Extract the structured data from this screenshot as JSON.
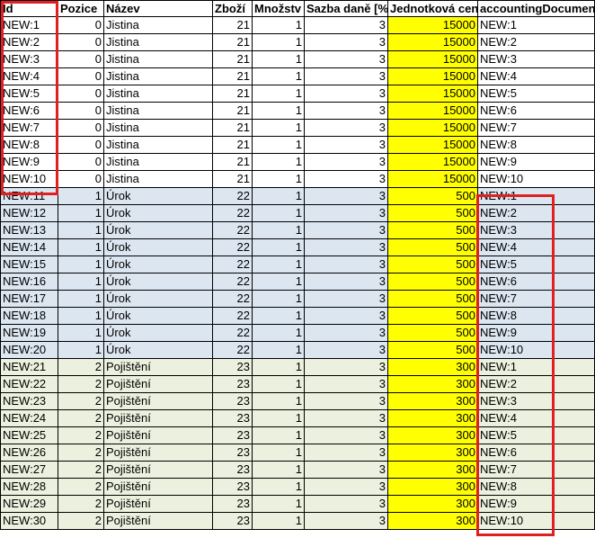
{
  "columns": [
    "Id",
    "Pozice",
    "Název",
    "Zboží",
    "Množstv",
    "Sazba daně [%",
    "Jednotková cen",
    "accountingDocumen"
  ],
  "rows": [
    [
      "NEW:1",
      "0",
      "Jistina",
      "21",
      "1",
      "3",
      "15000",
      "NEW:1"
    ],
    [
      "NEW:2",
      "0",
      "Jistina",
      "21",
      "1",
      "3",
      "15000",
      "NEW:2"
    ],
    [
      "NEW:3",
      "0",
      "Jistina",
      "21",
      "1",
      "3",
      "15000",
      "NEW:3"
    ],
    [
      "NEW:4",
      "0",
      "Jistina",
      "21",
      "1",
      "3",
      "15000",
      "NEW:4"
    ],
    [
      "NEW:5",
      "0",
      "Jistina",
      "21",
      "1",
      "3",
      "15000",
      "NEW:5"
    ],
    [
      "NEW:6",
      "0",
      "Jistina",
      "21",
      "1",
      "3",
      "15000",
      "NEW:6"
    ],
    [
      "NEW:7",
      "0",
      "Jistina",
      "21",
      "1",
      "3",
      "15000",
      "NEW:7"
    ],
    [
      "NEW:8",
      "0",
      "Jistina",
      "21",
      "1",
      "3",
      "15000",
      "NEW:8"
    ],
    [
      "NEW:9",
      "0",
      "Jistina",
      "21",
      "1",
      "3",
      "15000",
      "NEW:9"
    ],
    [
      "NEW:10",
      "0",
      "Jistina",
      "21",
      "1",
      "3",
      "15000",
      "NEW:10"
    ],
    [
      "NEW:11",
      "1",
      "Úrok",
      "22",
      "1",
      "3",
      "500",
      "NEW:1"
    ],
    [
      "NEW:12",
      "1",
      "Úrok",
      "22",
      "1",
      "3",
      "500",
      "NEW:2"
    ],
    [
      "NEW:13",
      "1",
      "Úrok",
      "22",
      "1",
      "3",
      "500",
      "NEW:3"
    ],
    [
      "NEW:14",
      "1",
      "Úrok",
      "22",
      "1",
      "3",
      "500",
      "NEW:4"
    ],
    [
      "NEW:15",
      "1",
      "Úrok",
      "22",
      "1",
      "3",
      "500",
      "NEW:5"
    ],
    [
      "NEW:16",
      "1",
      "Úrok",
      "22",
      "1",
      "3",
      "500",
      "NEW:6"
    ],
    [
      "NEW:17",
      "1",
      "Úrok",
      "22",
      "1",
      "3",
      "500",
      "NEW:7"
    ],
    [
      "NEW:18",
      "1",
      "Úrok",
      "22",
      "1",
      "3",
      "500",
      "NEW:8"
    ],
    [
      "NEW:19",
      "1",
      "Úrok",
      "22",
      "1",
      "3",
      "500",
      "NEW:9"
    ],
    [
      "NEW:20",
      "1",
      "Úrok",
      "22",
      "1",
      "3",
      "500",
      "NEW:10"
    ],
    [
      "NEW:21",
      "2",
      "Pojištění",
      "23",
      "1",
      "3",
      "300",
      "NEW:1"
    ],
    [
      "NEW:22",
      "2",
      "Pojištění",
      "23",
      "1",
      "3",
      "300",
      "NEW:2"
    ],
    [
      "NEW:23",
      "2",
      "Pojištění",
      "23",
      "1",
      "3",
      "300",
      "NEW:3"
    ],
    [
      "NEW:24",
      "2",
      "Pojištění",
      "23",
      "1",
      "3",
      "300",
      "NEW:4"
    ],
    [
      "NEW:25",
      "2",
      "Pojištění",
      "23",
      "1",
      "3",
      "300",
      "NEW:5"
    ],
    [
      "NEW:26",
      "2",
      "Pojištění",
      "23",
      "1",
      "3",
      "300",
      "NEW:6"
    ],
    [
      "NEW:27",
      "2",
      "Pojištění",
      "23",
      "1",
      "3",
      "300",
      "NEW:7"
    ],
    [
      "NEW:28",
      "2",
      "Pojištění",
      "23",
      "1",
      "3",
      "300",
      "NEW:8"
    ],
    [
      "NEW:29",
      "2",
      "Pojištění",
      "23",
      "1",
      "3",
      "300",
      "NEW:9"
    ],
    [
      "NEW:30",
      "2",
      "Pojištění",
      "23",
      "1",
      "3",
      "300",
      "NEW:10"
    ]
  ],
  "colors": {
    "group_1": "#ffffff",
    "group_2": "#dce6f1",
    "group_3": "#ebf1de",
    "unit_price_highlight": "#ffff00",
    "annotation_box": "#e02020"
  }
}
